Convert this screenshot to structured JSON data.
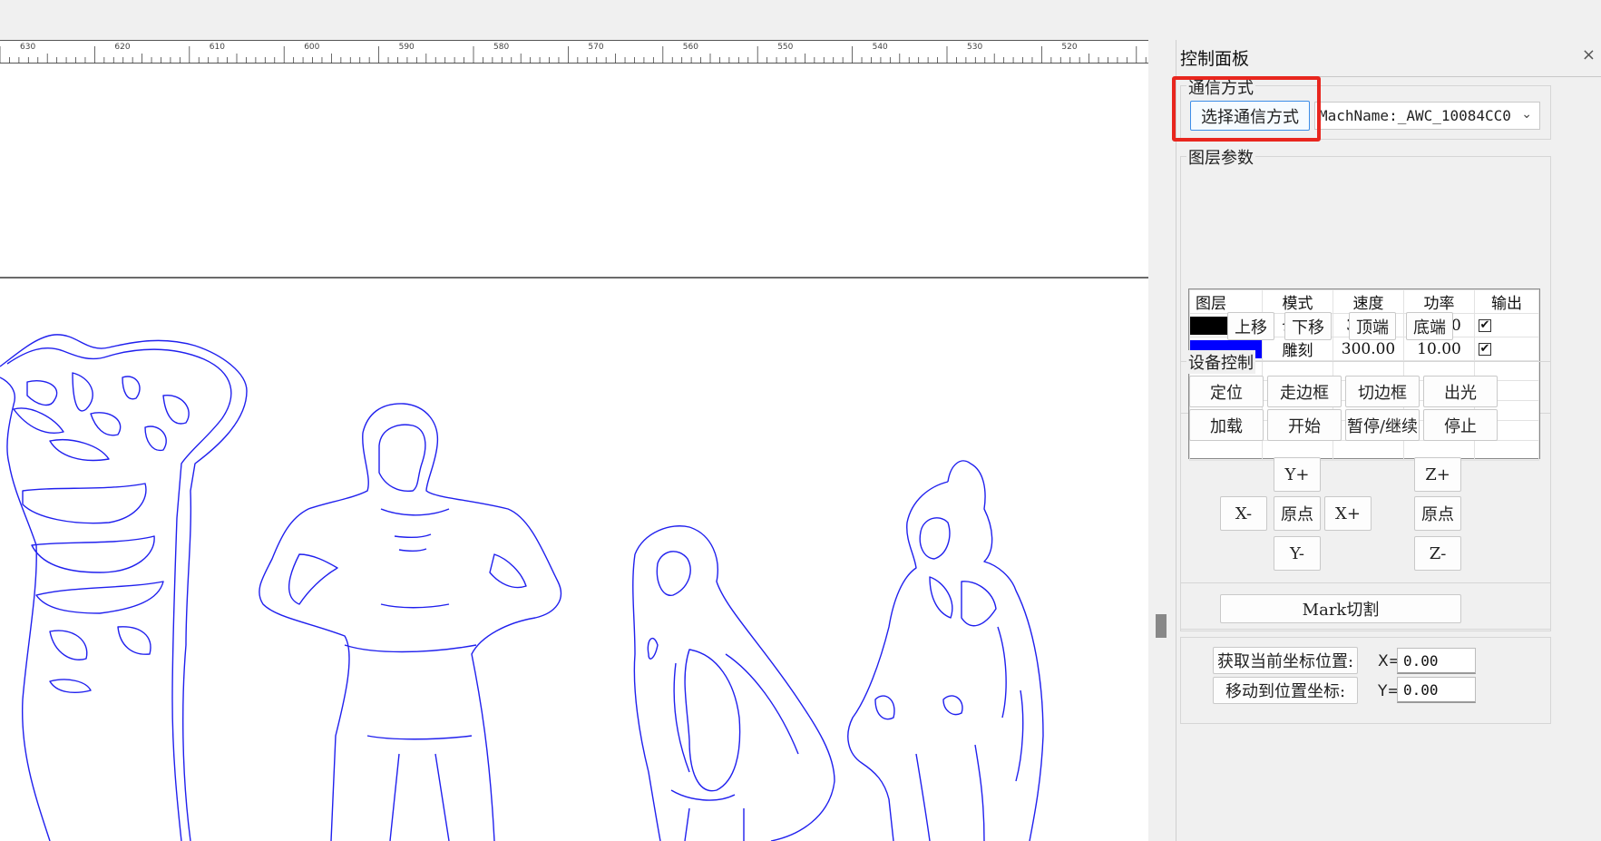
{
  "ruler": {
    "labels": [
      "630",
      "620",
      "610",
      "600",
      "590",
      "580",
      "570",
      "560",
      "550",
      "540",
      "530",
      "520"
    ]
  },
  "panel": {
    "title": "控制面板",
    "close_icon": "close-icon",
    "communication": {
      "group_title": "通信方式",
      "select_button": "选择通信方式",
      "machine_select_value": "MachName:_AWC_10084CC0"
    },
    "layers": {
      "group_title": "图层参数",
      "columns": [
        "图层",
        "模式",
        "速度",
        "功率",
        "输出"
      ],
      "rows": [
        {
          "color": "#000000",
          "mode": "切割",
          "speed": "30.00",
          "power": "60.00",
          "output": true
        },
        {
          "color": "#0000ff",
          "mode": "雕刻",
          "speed": "300.00",
          "power": "10.00",
          "output": true
        }
      ],
      "buttons": {
        "up": "上移",
        "down": "下移",
        "top": "顶端",
        "bottom": "底端"
      }
    },
    "device": {
      "group_title": "设备控制",
      "buttons": {
        "locate": "定位",
        "frame": "走边框",
        "cut_frame": "切边框",
        "laser": "出光",
        "load": "加载",
        "start": "开始",
        "pause": "暂停/继续",
        "stop": "停止"
      },
      "jog": {
        "y_plus": "Y+",
        "y_minus": "Y-",
        "x_minus": "X-",
        "x_plus": "X+",
        "origin_xy": "原点",
        "z_plus": "Z+",
        "z_minus": "Z-",
        "origin_z": "原点"
      }
    },
    "mark_cut": "Mark切割",
    "position": {
      "get_current": "获取当前坐标位置:",
      "move_to": "移动到位置坐标:",
      "x_label": "X=",
      "y_label": "Y=",
      "x_value": "0.00",
      "y_value": "0.00"
    }
  },
  "colors": {
    "outline": "#2020ee",
    "highlight": "#e8261e",
    "focus": "#3d8ee8"
  }
}
